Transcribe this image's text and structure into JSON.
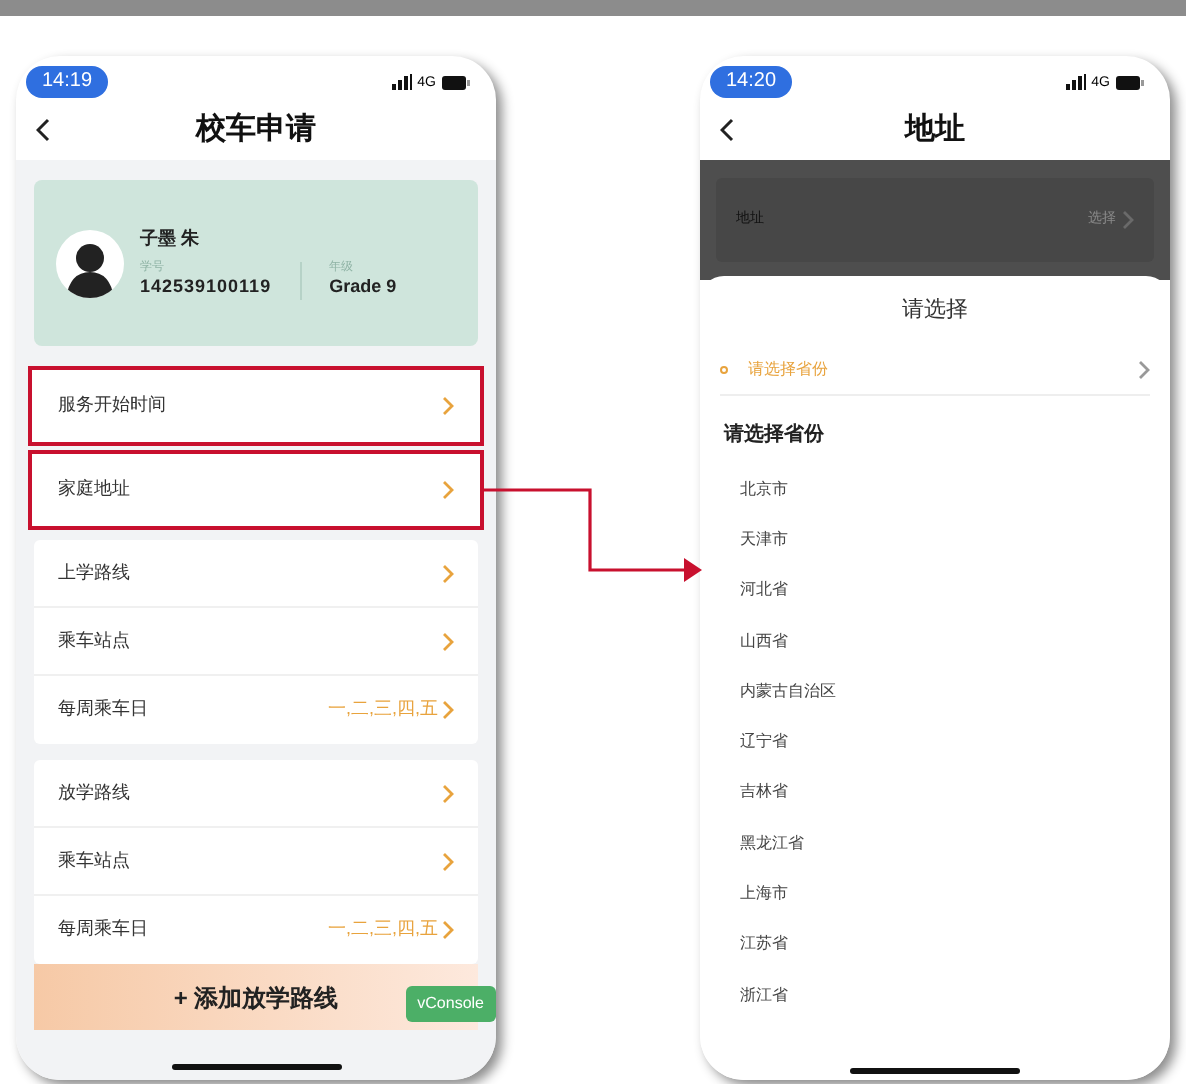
{
  "application_screen": {
    "status_bar": {
      "time": "14:19",
      "network": "4G"
    },
    "title": "校车申请",
    "student": {
      "name": "子墨 朱",
      "id_label": "学号",
      "id": "142539100119",
      "grade_label": "年级",
      "grade": "Grade 9"
    },
    "groups": [
      {
        "highlighted": true,
        "rows": [
          {
            "label": "服务开始时间"
          }
        ]
      },
      {
        "highlighted": true,
        "rows": [
          {
            "label": "家庭地址"
          }
        ]
      },
      {
        "highlighted": false,
        "rows": [
          {
            "label": "上学路线"
          },
          {
            "label": "乘车站点"
          },
          {
            "label": "每周乘车日",
            "value": "一,二,三,四,五"
          }
        ]
      },
      {
        "highlighted": false,
        "rows": [
          {
            "label": "放学路线"
          },
          {
            "label": "乘车站点"
          },
          {
            "label": "每周乘车日",
            "value": "一,二,三,四,五"
          }
        ]
      }
    ],
    "add_button": "+ 添加放学路线",
    "debug_button": "vConsole"
  },
  "address_screen": {
    "status_bar": {
      "time": "14:20",
      "network": "4G"
    },
    "title": "地址",
    "field": {
      "label": "地址",
      "value": "选择"
    },
    "sheet": {
      "title": "请选择",
      "tabs": [
        {
          "label": "请选择省份",
          "selected": true
        }
      ],
      "heading": "请选择省份",
      "options": [
        "北京市",
        "天津市",
        "河北省",
        "山西省",
        "内蒙古自治区",
        "辽宁省",
        "吉林省",
        "黑龙江省",
        "上海市",
        "江苏省",
        "浙江省"
      ]
    }
  }
}
